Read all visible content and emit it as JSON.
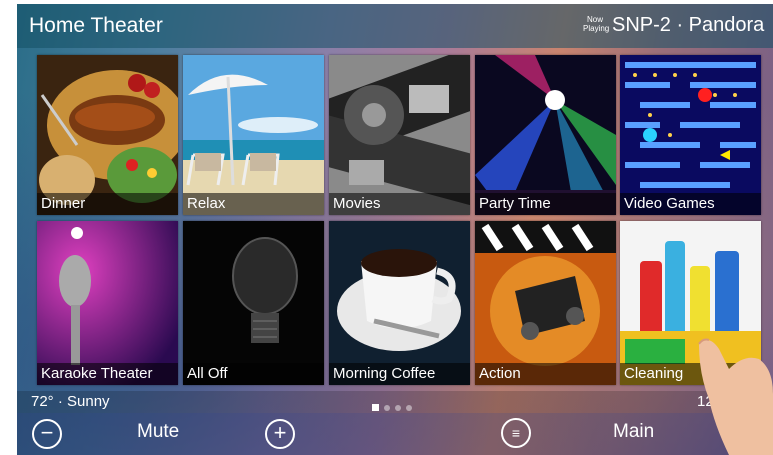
{
  "header": {
    "title": "Home Theater",
    "now_playing_label": "Now Playing",
    "source": "SNP-2 · Pandora"
  },
  "tiles": [
    {
      "label": "Dinner"
    },
    {
      "label": "Relax"
    },
    {
      "label": "Movies"
    },
    {
      "label": "Party Time"
    },
    {
      "label": "Video Games"
    },
    {
      "label": "Karaoke Theater"
    },
    {
      "label": "All Off"
    },
    {
      "label": "Morning Coffee"
    },
    {
      "label": "Action"
    },
    {
      "label": "Cleaning"
    }
  ],
  "status": {
    "weather": "72° · Sunny",
    "time": "12"
  },
  "pager": {
    "current": 1,
    "total": 4
  },
  "footer": {
    "mute_label": "Mute",
    "main_label": "Main"
  },
  "icons": {
    "vol_down": "minus-circle-icon",
    "vol_up": "plus-circle-icon",
    "menu": "menu-circle-icon"
  }
}
